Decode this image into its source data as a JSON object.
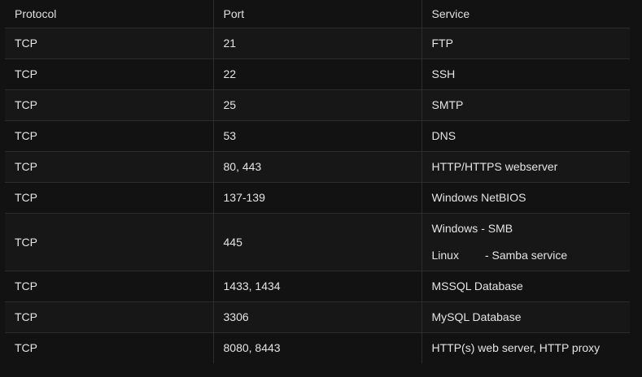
{
  "headers": {
    "protocol": "Protocol",
    "port": "Port",
    "service": "Service"
  },
  "rows": [
    {
      "protocol": "TCP",
      "port": "21",
      "service": "FTP"
    },
    {
      "protocol": "TCP",
      "port": "22",
      "service": "SSH"
    },
    {
      "protocol": "TCP",
      "port": "25",
      "service": "SMTP"
    },
    {
      "protocol": "TCP",
      "port": "53",
      "service": "DNS"
    },
    {
      "protocol": "TCP",
      "port": "80, 443",
      "service": "HTTP/HTTPS webserver"
    },
    {
      "protocol": "TCP",
      "port": "137-139",
      "service": "Windows NetBIOS"
    },
    {
      "protocol": "TCP",
      "port": "445",
      "service_line1_os": "Windows",
      "service_line1_desc": "- SMB",
      "service_line2_os": "Linux",
      "service_line2_desc": "- Samba service"
    },
    {
      "protocol": "TCP",
      "port": "1433, 1434",
      "service": "MSSQL Database"
    },
    {
      "protocol": "TCP",
      "port": "3306",
      "service": "MySQL Database"
    },
    {
      "protocol": "TCP",
      "port": "8080, 8443",
      "service": "HTTP(s) web server, HTTP proxy"
    }
  ]
}
